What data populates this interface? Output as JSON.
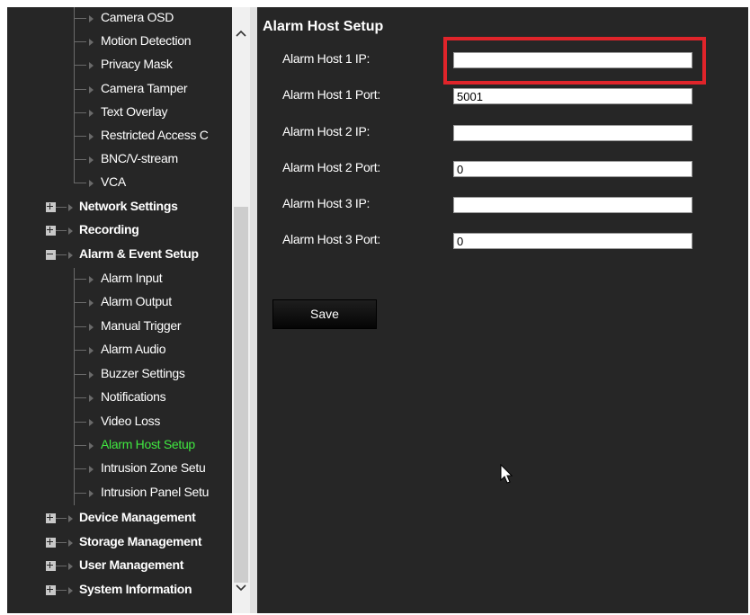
{
  "sidebar": {
    "items": [
      {
        "label": "Camera OSD",
        "type": "sub"
      },
      {
        "label": "Motion Detection",
        "type": "sub"
      },
      {
        "label": "Privacy Mask",
        "type": "sub"
      },
      {
        "label": "Camera Tamper",
        "type": "sub"
      },
      {
        "label": "Text Overlay",
        "type": "sub"
      },
      {
        "label": "Restricted Access C",
        "type": "sub"
      },
      {
        "label": "BNC/V-stream",
        "type": "sub"
      },
      {
        "label": "VCA",
        "type": "sub"
      },
      {
        "label": "Network Settings",
        "type": "category"
      },
      {
        "label": "Recording",
        "type": "category"
      },
      {
        "label": "Alarm & Event Setup",
        "type": "category",
        "expanded": true
      },
      {
        "label": "Alarm Input",
        "type": "sub"
      },
      {
        "label": "Alarm Output",
        "type": "sub"
      },
      {
        "label": "Manual Trigger",
        "type": "sub"
      },
      {
        "label": "Alarm Audio",
        "type": "sub"
      },
      {
        "label": "Buzzer Settings",
        "type": "sub"
      },
      {
        "label": "Notifications",
        "type": "sub"
      },
      {
        "label": "Video Loss",
        "type": "sub"
      },
      {
        "label": "Alarm Host Setup",
        "type": "sub",
        "active": true
      },
      {
        "label": "Intrusion Zone Setu",
        "type": "sub"
      },
      {
        "label": "Intrusion Panel Setu",
        "type": "sub"
      },
      {
        "label": "Device Management",
        "type": "category"
      },
      {
        "label": "Storage Management",
        "type": "category"
      },
      {
        "label": "User Management",
        "type": "category"
      },
      {
        "label": "System Information",
        "type": "category"
      }
    ]
  },
  "main": {
    "title": "Alarm Host Setup",
    "fields": [
      {
        "label": "Alarm Host 1 IP:",
        "value": ""
      },
      {
        "label": "Alarm Host 1 Port:",
        "value": "5001"
      },
      {
        "label": "Alarm Host 2 IP:",
        "value": ""
      },
      {
        "label": "Alarm Host 2 Port:",
        "value": "0"
      },
      {
        "label": "Alarm Host 3 IP:",
        "value": ""
      },
      {
        "label": "Alarm Host 3 Port:",
        "value": "0"
      }
    ],
    "save_label": "Save"
  },
  "colors": {
    "background": "#262626",
    "active_item": "#40e840",
    "highlight": "#e0242a"
  }
}
